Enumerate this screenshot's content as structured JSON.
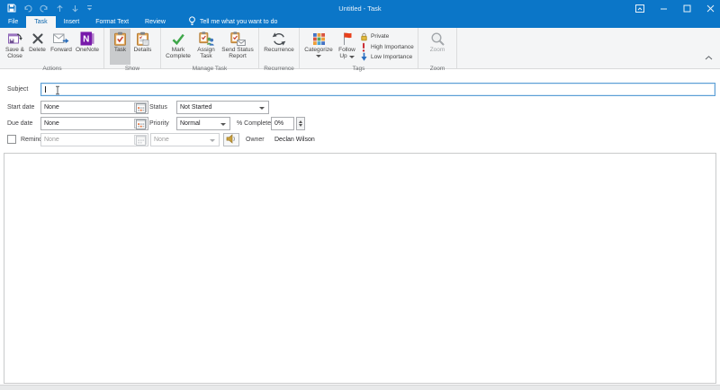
{
  "titlebar": {
    "title": "Untitled - Task"
  },
  "tabs": {
    "file": "File",
    "task": "Task",
    "insert": "Insert",
    "format_text": "Format Text",
    "review": "Review",
    "tellme": "Tell me what you want to do"
  },
  "ribbon": {
    "groups": {
      "actions": {
        "label": "Actions",
        "save_close": "Save & Close",
        "delete": "Delete",
        "forward": "Forward",
        "onenote": "OneNote"
      },
      "show": {
        "label": "Show",
        "task": "Task",
        "details": "Details"
      },
      "manage": {
        "label": "Manage Task",
        "mark_complete": "Mark Complete",
        "assign_task": "Assign Task",
        "send_status": "Send Status Report"
      },
      "recurrence": {
        "label": "Recurrence",
        "recurrence": "Recurrence"
      },
      "tags": {
        "label": "Tags",
        "categorize": "Categorize",
        "follow_up": "Follow Up",
        "private": "Private",
        "high": "High Importance",
        "low": "Low Importance"
      },
      "zoom": {
        "label": "Zoom",
        "zoom": "Zoom"
      }
    }
  },
  "form": {
    "subject": {
      "label": "Subject",
      "value": ""
    },
    "start_date": {
      "label": "Start date",
      "value": "None"
    },
    "status": {
      "label": "Status",
      "value": "Not Started"
    },
    "due_date": {
      "label": "Due date",
      "value": "None"
    },
    "priority": {
      "label": "Priority",
      "value": "Normal"
    },
    "percent_complete": {
      "label": "% Complete",
      "value": "0%"
    },
    "reminder": {
      "label": "Reminder",
      "date": "None",
      "time": "None",
      "checked": false
    },
    "owner": {
      "label": "Owner",
      "value": "Declan Wilson"
    }
  },
  "colors": {
    "titlebar_blue": "#0b76c8",
    "selected_tab_text": "#0a66ae",
    "flag_red": "#e8401c",
    "importance_red": "#c9242b",
    "low_importance_blue": "#2a6fc0",
    "check_green": "#3fa74a",
    "onenote_purple": "#7719aa"
  }
}
